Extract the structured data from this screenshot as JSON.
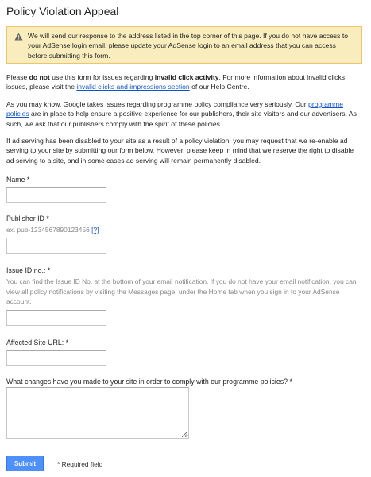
{
  "page_title": "Policy Violation Appeal",
  "alert": {
    "icon": "warning-icon",
    "text": "We will send our response to the address listed in the top corner of this page. If you do not have access to your AdSense login email, please update your AdSense login to an email address that you can access before submitting this form."
  },
  "intro": {
    "p1_before": "Please ",
    "p1_do_not": "do not",
    "p1_mid": " use this form for issues regarding ",
    "p1_bold": "invalid click activity",
    "p1_after": ". For more information about invalid clicks issues, please visit the ",
    "p1_link": "invalid clicks and impressions section",
    "p1_end": " of our Help Centre.",
    "p2_before": "As you may know, Google takes issues regarding programme policy compliance very seriously. Our ",
    "p2_link": "programme policies",
    "p2_after": " are in place to help ensure a positive experience for our publishers, their site visitors and our advertisers. As such, we ask that our publishers comply with the spirit of these policies.",
    "p3": "If ad serving has been disabled to your site as a result of a policy violation, you may request that we re-enable ad serving to your site by submitting our form below. However, please keep in mind that we reserve the right to disable ad serving to a site, and in some cases ad serving will remain permanently disabled."
  },
  "form": {
    "name_label": "Name *",
    "name_value": "",
    "publisher_label": "Publisher ID *",
    "publisher_hint": "ex. pub-1234567890123456",
    "publisher_help_link": "[?]",
    "publisher_value": "",
    "issue_label": "Issue ID no.: *",
    "issue_help": "You can find the Issue ID No. at the bottom of your email notification. If you do not have your email notification, you can view all policy notifications by visiting the Messages page, under the Home tab when you sign in to your AdSense account.",
    "issue_value": "",
    "site_label": "Affected Site URL: *",
    "site_value": "",
    "changes_label": "What changes have you made to your site in order to comply with our programme policies? *",
    "changes_value": "",
    "submit_label": "Submit",
    "required_note": "* Required field"
  }
}
